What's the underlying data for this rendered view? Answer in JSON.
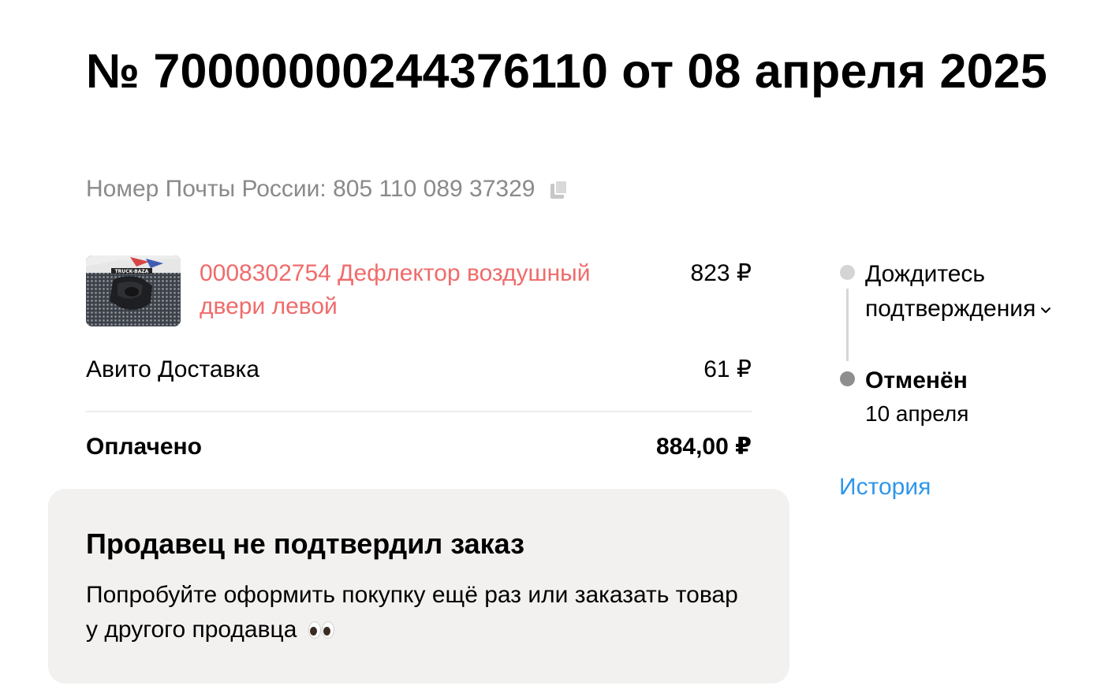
{
  "order": {
    "title": "№ 70000000244376110 от 08 апреля 2025",
    "post_label": "Номер Почты России: 805 110 089 37329",
    "copy_icon": "copy-icon"
  },
  "items": [
    {
      "name": "0008302754 Дефлектор воздушный двери левой",
      "price": "823 ₽",
      "thumb_caption": "TRUCK-BAZA"
    }
  ],
  "delivery": {
    "label": "Авито Доставка",
    "price": "61 ₽"
  },
  "summary": {
    "paid_label": "Оплачено",
    "paid_total": "884,00 ₽"
  },
  "notice": {
    "title": "Продавец не подтвердил заказ",
    "text": "Попробуйте оформить покупку ещё раз или заказать товар у другого продавца",
    "emoji": "eyes-icon"
  },
  "timeline": {
    "step1_label": "Дождитесь подтверждения",
    "step2_label": "Отменён",
    "step2_date": "10 апреля"
  },
  "links": {
    "history": "История"
  },
  "colors": {
    "item_link": "#f06b6b",
    "history_link": "#2f96ea",
    "muted_text": "#8a8a8a",
    "notice_bg": "#f2f1f0",
    "timeline_dot_pending": "#d4d4d4",
    "timeline_dot_current": "#8e8e8e"
  }
}
